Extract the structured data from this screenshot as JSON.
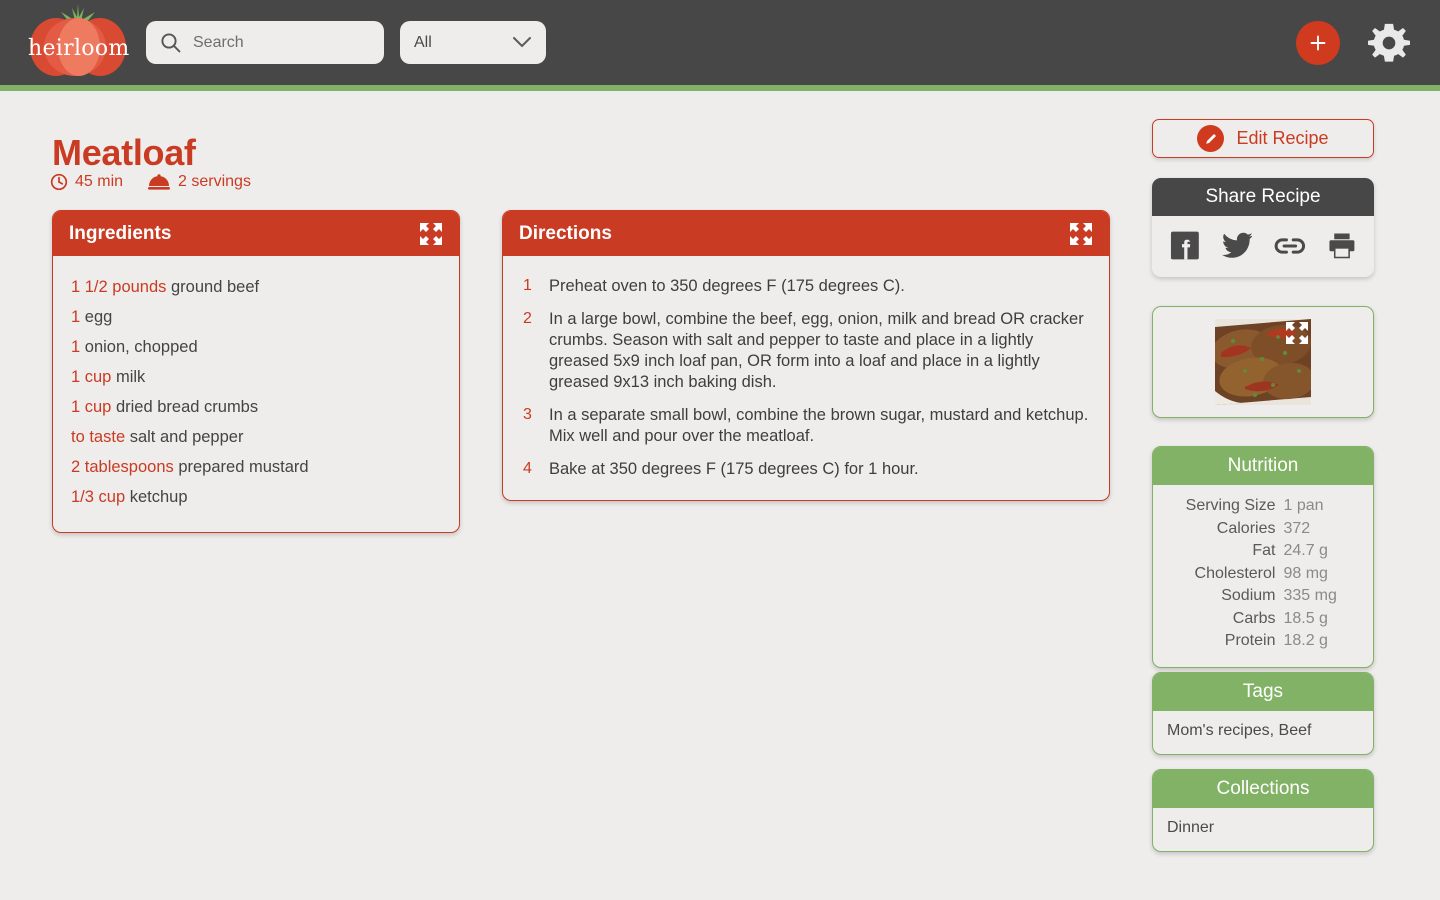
{
  "app": {
    "logo_text": "heirloom",
    "logo_icon": "tomato-icon"
  },
  "topbar": {
    "search": {
      "placeholder": "Search",
      "value": "",
      "icon": "search-icon"
    },
    "filter": {
      "value": "All",
      "icon": "chevron-down-icon",
      "options": [
        "All"
      ]
    },
    "add_button": {
      "label": "+",
      "icon": "plus-icon"
    },
    "settings_button": {
      "icon": "gear-icon"
    }
  },
  "recipe": {
    "title": "Meatloaf",
    "time": "45 min",
    "time_icon": "clock-icon",
    "servings": "2 servings",
    "servings_icon": "serving-dome-icon",
    "image_alt": "meatloaf-photo",
    "expand_icon": "expand-icon"
  },
  "ingredients_card": {
    "title": "Ingredients",
    "expand_icon": "expand-icon",
    "items": [
      {
        "quantity": "1 1/2 pounds",
        "name": "ground beef"
      },
      {
        "quantity": "1",
        "name": "egg"
      },
      {
        "quantity": "1",
        "name": "onion, chopped"
      },
      {
        "quantity": "1 cup",
        "name": "milk"
      },
      {
        "quantity": "1 cup",
        "name": "dried bread crumbs"
      },
      {
        "quantity": "to taste",
        "name": "salt and pepper"
      },
      {
        "quantity": "2 tablespoons",
        "name": "prepared mustard"
      },
      {
        "quantity": "1/3 cup",
        "name": "ketchup"
      }
    ]
  },
  "directions_card": {
    "title": "Directions",
    "expand_icon": "expand-icon",
    "steps": [
      {
        "number": "1",
        "text": "Preheat oven to 350 degrees F (175 degrees C)."
      },
      {
        "number": "2",
        "text": "In a large bowl, combine the beef, egg, onion, milk and bread OR cracker crumbs. Season with salt and pepper to taste and place in a lightly greased 5x9 inch loaf pan, OR form into a loaf and place in a lightly greased 9x13 inch baking dish."
      },
      {
        "number": "3",
        "text": "In a separate small bowl, combine the brown sugar, mustard and ketchup. Mix well and pour over the meatloaf."
      },
      {
        "number": "4",
        "text": "Bake at 350 degrees F (175 degrees C) for 1 hour."
      }
    ]
  },
  "sidebar": {
    "edit_button": {
      "label": "Edit Recipe",
      "icon": "pencil-icon"
    },
    "share": {
      "title": "Share Recipe",
      "buttons": [
        {
          "name": "facebook-icon",
          "label": "Facebook"
        },
        {
          "name": "twitter-icon",
          "label": "Twitter"
        },
        {
          "name": "link-icon",
          "label": "Copy link"
        },
        {
          "name": "print-icon",
          "label": "Print"
        }
      ]
    },
    "nutrition": {
      "title": "Nutrition",
      "rows": [
        {
          "label": "Serving Size",
          "value": "1 pan"
        },
        {
          "label": "Calories",
          "value": "372"
        },
        {
          "label": "Fat",
          "value": "24.7 g"
        },
        {
          "label": "Cholesterol",
          "value": "98 mg"
        },
        {
          "label": "Sodium",
          "value": "335 mg"
        },
        {
          "label": "Carbs",
          "value": "18.5 g"
        },
        {
          "label": "Protein",
          "value": "18.2 g"
        }
      ]
    },
    "tags": {
      "title": "Tags",
      "value": "Mom's recipes, Beef"
    },
    "collections": {
      "title": "Collections",
      "value": "Dinner"
    }
  },
  "colors": {
    "brand_red": "#C93B22",
    "accent_red": "#D03A1E",
    "green": "#82B266",
    "dark": "#474747",
    "page_bg": "#EFEDEC"
  }
}
